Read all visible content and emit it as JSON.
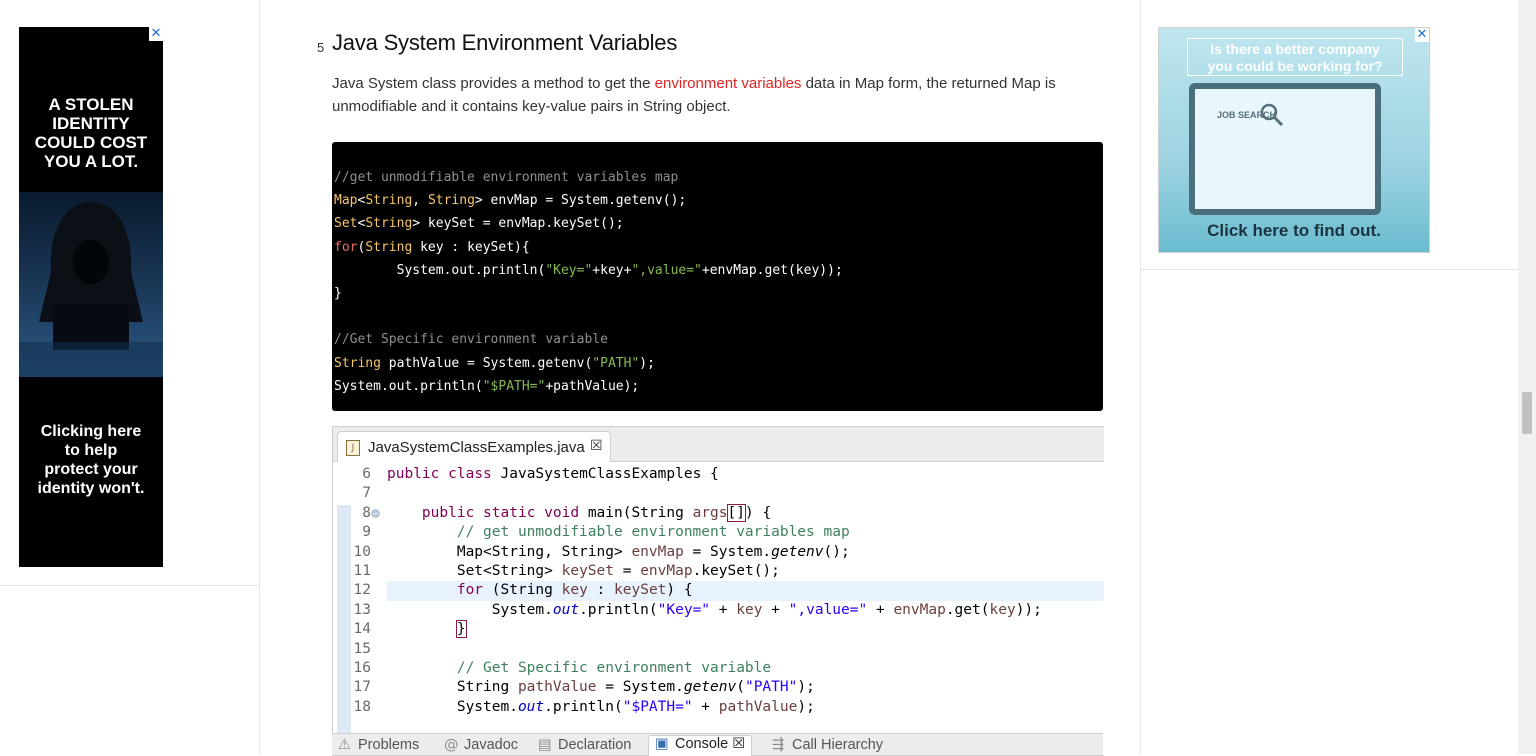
{
  "left_ad": {
    "headline": [
      "A STOLEN",
      "IDENTITY",
      "COULD COST",
      "YOU A LOT."
    ],
    "footer": [
      "Clicking here",
      "to help",
      "protect your",
      "identity won't."
    ],
    "close": "✕"
  },
  "right_ad": {
    "question": [
      "Is there a better company",
      "you could be working for?"
    ],
    "screen_text": "JOB SEARCH",
    "cta": "Click here to find out.",
    "close": "✕"
  },
  "section": {
    "number": "5",
    "title": "Java System Environment Variables",
    "intro_before": "Java System class provides a method to get the ",
    "intro_link": "environment variables",
    "intro_after": " data in Map form, the returned Map is unmodifiable and it contains key-value pairs in String object."
  },
  "code_block": {
    "lines": [
      "//get unmodifiable environment variables map",
      "Map<String, String> envMap = System.getenv();",
      "Set<String> keySet = envMap.keySet();",
      "for(String key : keySet){",
      "        System.out.println(\"Key=\"+key+\",value=\"+envMap.get(key));",
      "}",
      "",
      "//Get Specific environment variable",
      "String pathValue = System.getenv(\"PATH\");",
      "System.out.println(\"$PATH=\"+pathValue);"
    ]
  },
  "ide": {
    "file_tab": "JavaSystemClassExamples.java",
    "line_numbers": [
      "6",
      "7",
      "8",
      "9",
      "10",
      "11",
      "12",
      "13",
      "14",
      "15",
      "16",
      "17",
      "18"
    ],
    "highlighted_line": "12",
    "panel_tabs": [
      "Problems",
      "Javadoc",
      "Declaration",
      "Console",
      "Call Hierarchy"
    ],
    "active_panel_tab": "Console"
  },
  "colors": {
    "link": "#e02424",
    "code_bg": "#000000",
    "code_comment": "#8f8f8f",
    "code_type": "#f4c56a",
    "code_keyword": "#ec6a5e",
    "code_string": "#86b94f",
    "ide_keyword": "#7f0055",
    "ide_comment": "#3f7f5f",
    "ide_string": "#2a00ff"
  }
}
